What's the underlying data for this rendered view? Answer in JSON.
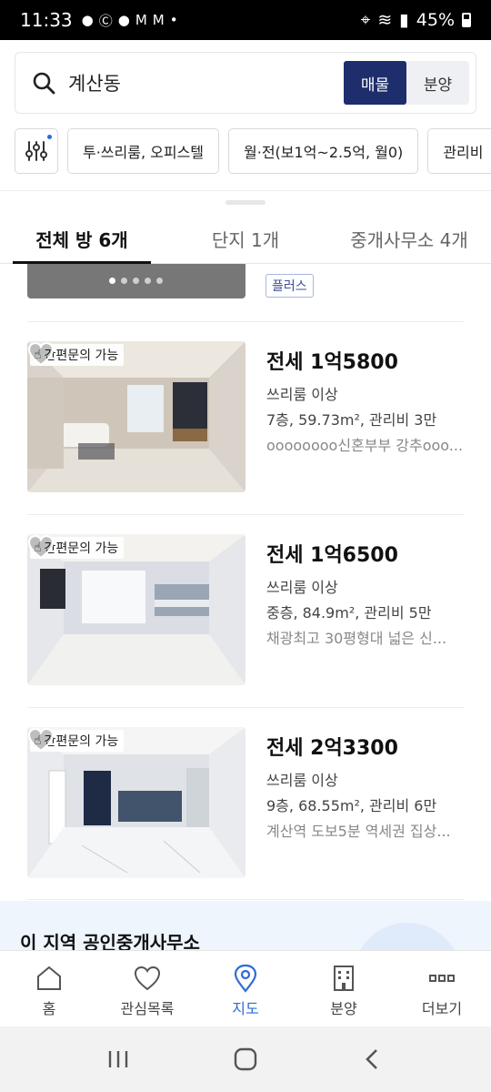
{
  "status": {
    "time": "11:33",
    "battery": "45%"
  },
  "search": {
    "query": "계산동",
    "seg_listings": "매물",
    "seg_presale": "분양"
  },
  "filters": [
    "투·쓰리룸, 오피스텔",
    "월·전(보1억~2.5억, 월0)",
    "관리비"
  ],
  "tabs": {
    "all": "전체 방 6개",
    "complex": "단지 1개",
    "agents": "중개사무소 4개"
  },
  "plus_badge": "플러스",
  "listings": [
    {
      "badge": "간편문의 가능",
      "price": "전세 1억5800",
      "type": "쓰리룸 이상",
      "spec": "7층, 59.73m², 관리비 3만",
      "desc": "oooooooo신혼부부 강추ooo..."
    },
    {
      "badge": "간편문의 가능",
      "price": "전세 1억6500",
      "type": "쓰리룸 이상",
      "spec": "중층, 84.9m², 관리비 5만",
      "desc": "채광최고 30평형대 넓은 신..."
    },
    {
      "badge": "간편문의 가능",
      "price": "전세 2억3300",
      "type": "쓰리룸 이상",
      "spec": "9층, 68.55m², 관리비 6만",
      "desc": "계산역 도보5분 역세권 집상..."
    }
  ],
  "office_section": {
    "title": "이 지역 공인중개사무소"
  },
  "bottom_nav": {
    "home": "홈",
    "favorites": "관심목록",
    "map": "지도",
    "presale": "분양",
    "more": "더보기"
  },
  "colors": {
    "accent": "#1e2d6b",
    "active_nav": "#2f6bd6"
  }
}
